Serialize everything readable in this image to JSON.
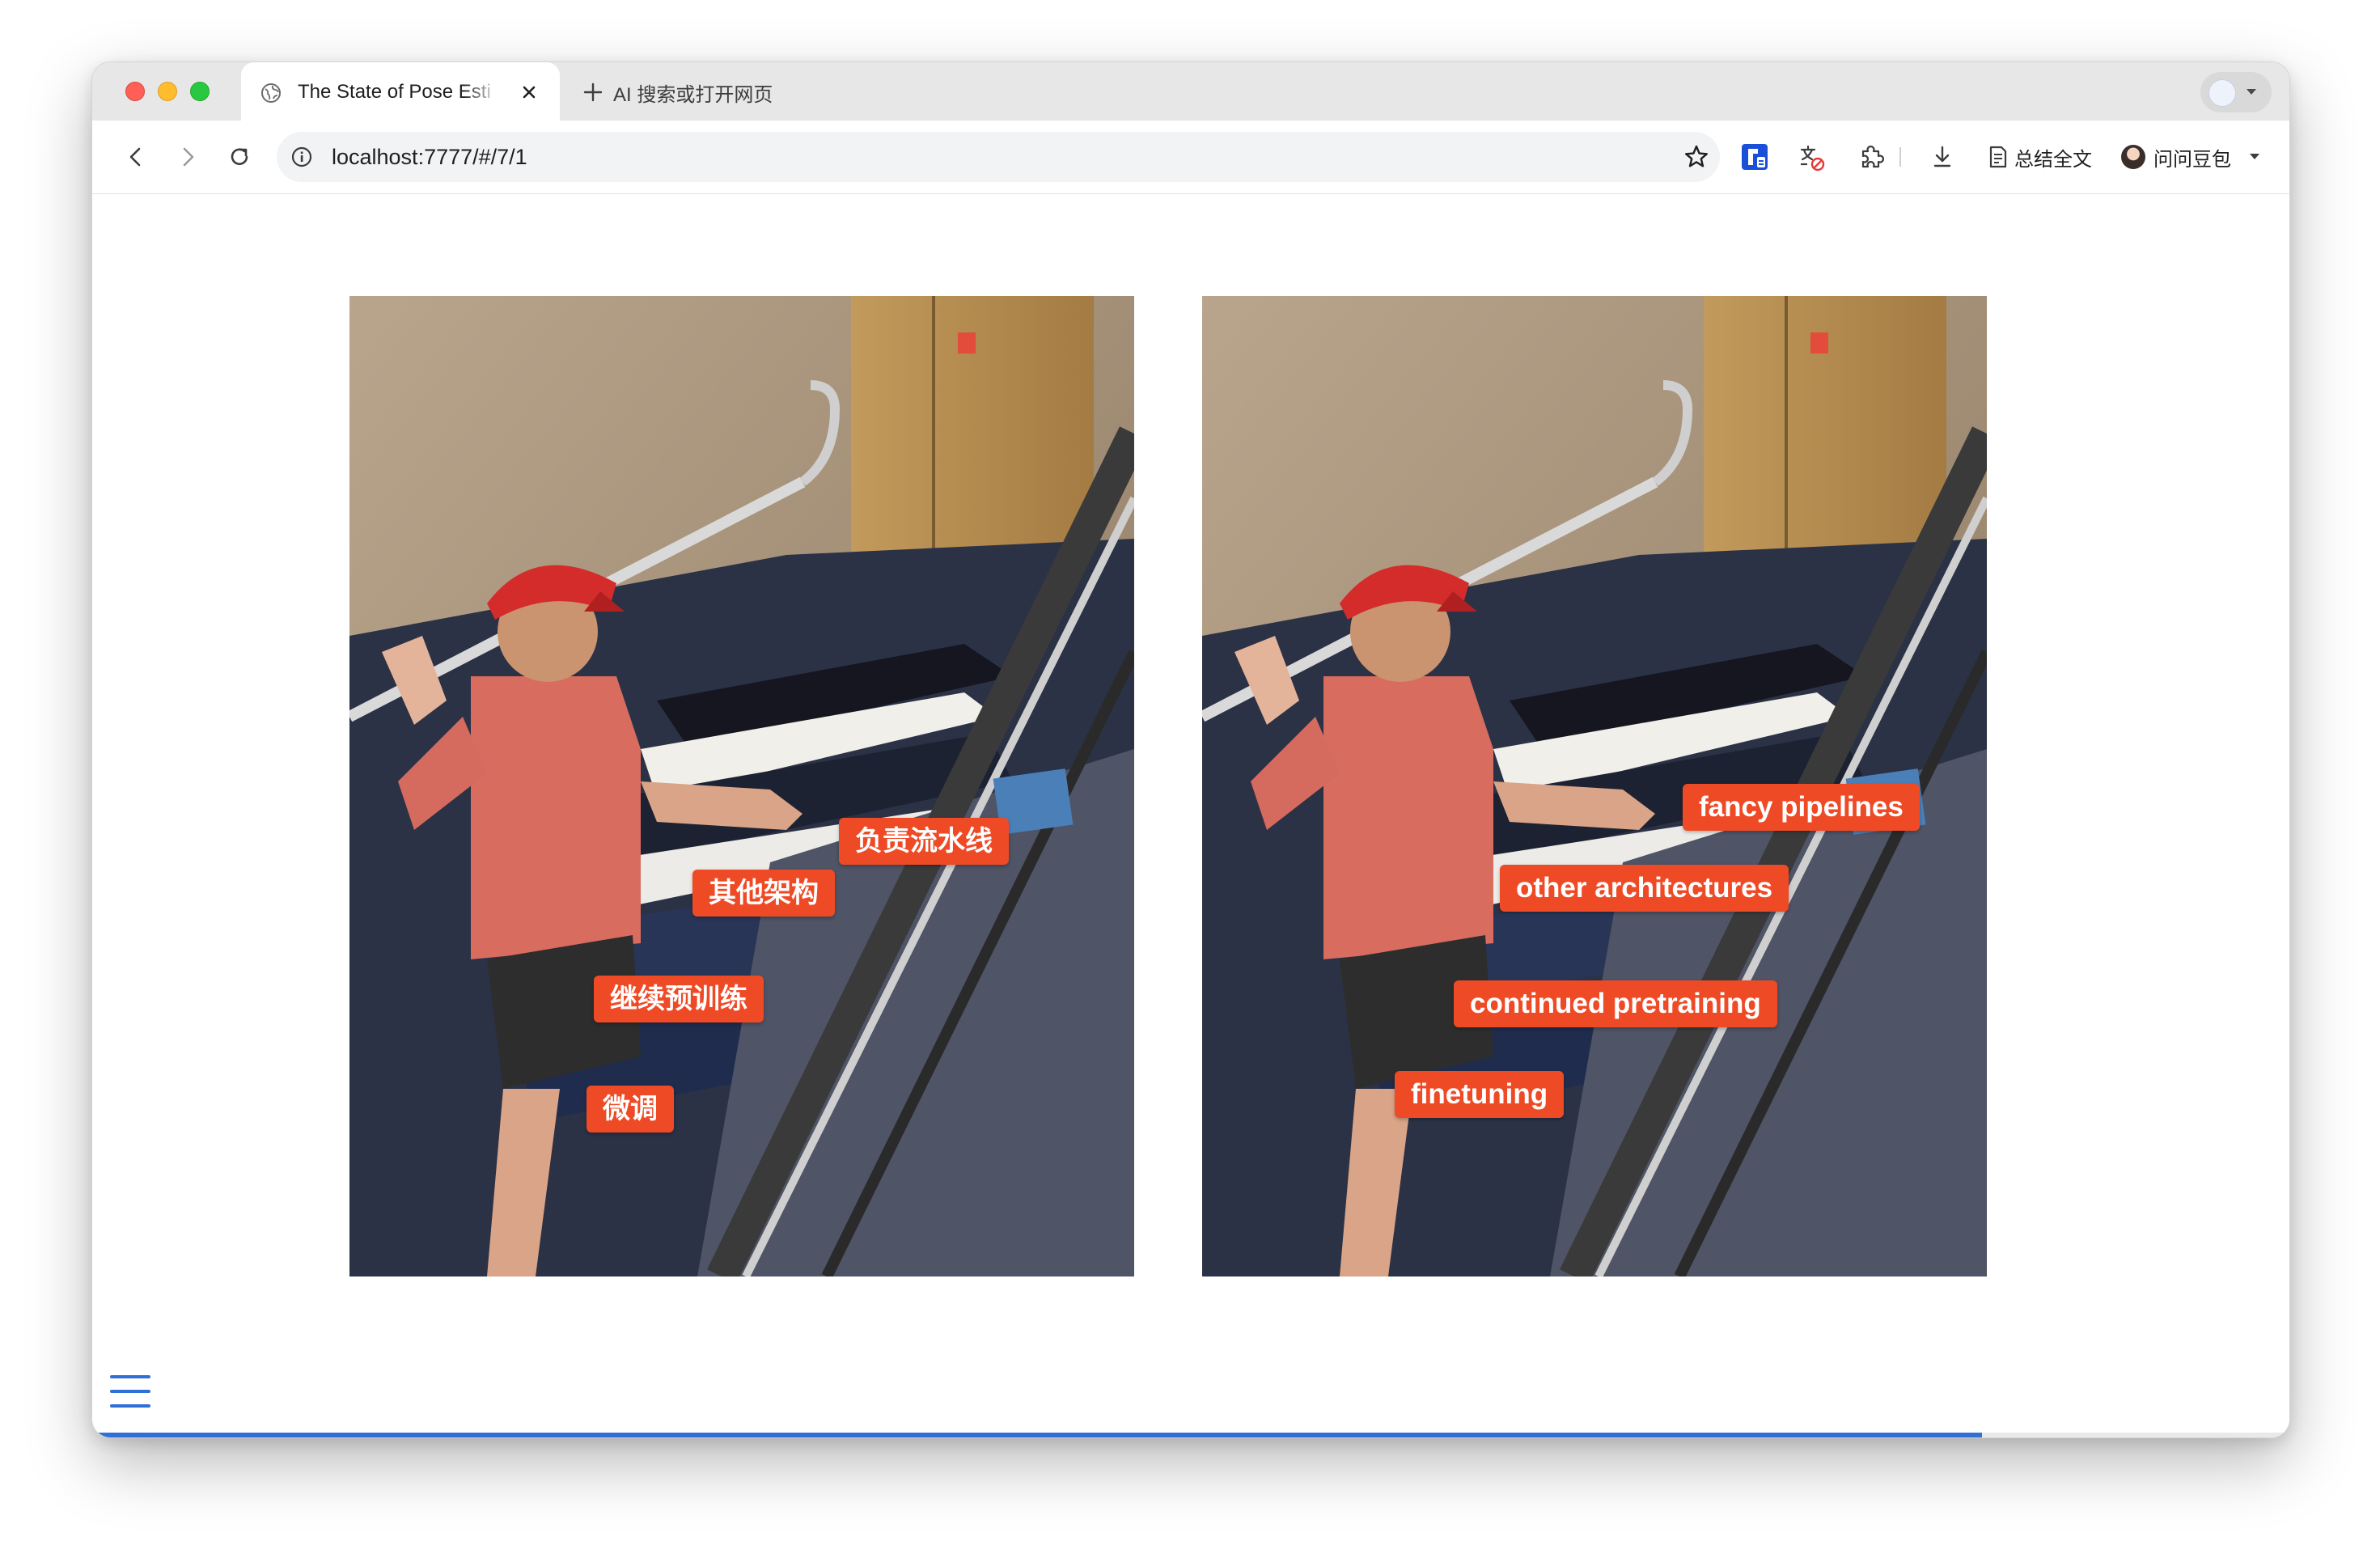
{
  "browser": {
    "tab": {
      "title": "The State of Pose Esti",
      "favicon": "globe-icon"
    },
    "new_tab_label": "AI 搜索或打开网页",
    "url": "localhost:7777/#/7/1",
    "toolbar_actions": {
      "summary_label": "总结全文",
      "doubao_label": "问问豆包"
    }
  },
  "slide": {
    "left_image": {
      "language": "zh",
      "labels": [
        "负责流水线",
        "其他架构",
        "继续预训练",
        "微调"
      ]
    },
    "right_image": {
      "language": "en",
      "labels": [
        "fancy pipelines",
        "other architectures",
        "continued pretraining",
        "finetuning"
      ]
    },
    "progress_fraction": 0.86,
    "menu_icon": "hamburger-menu-icon"
  },
  "colors": {
    "label_background": "#ef4a26",
    "progress_bar": "#2f6fd6",
    "menu_icon": "#2f6fd6"
  }
}
